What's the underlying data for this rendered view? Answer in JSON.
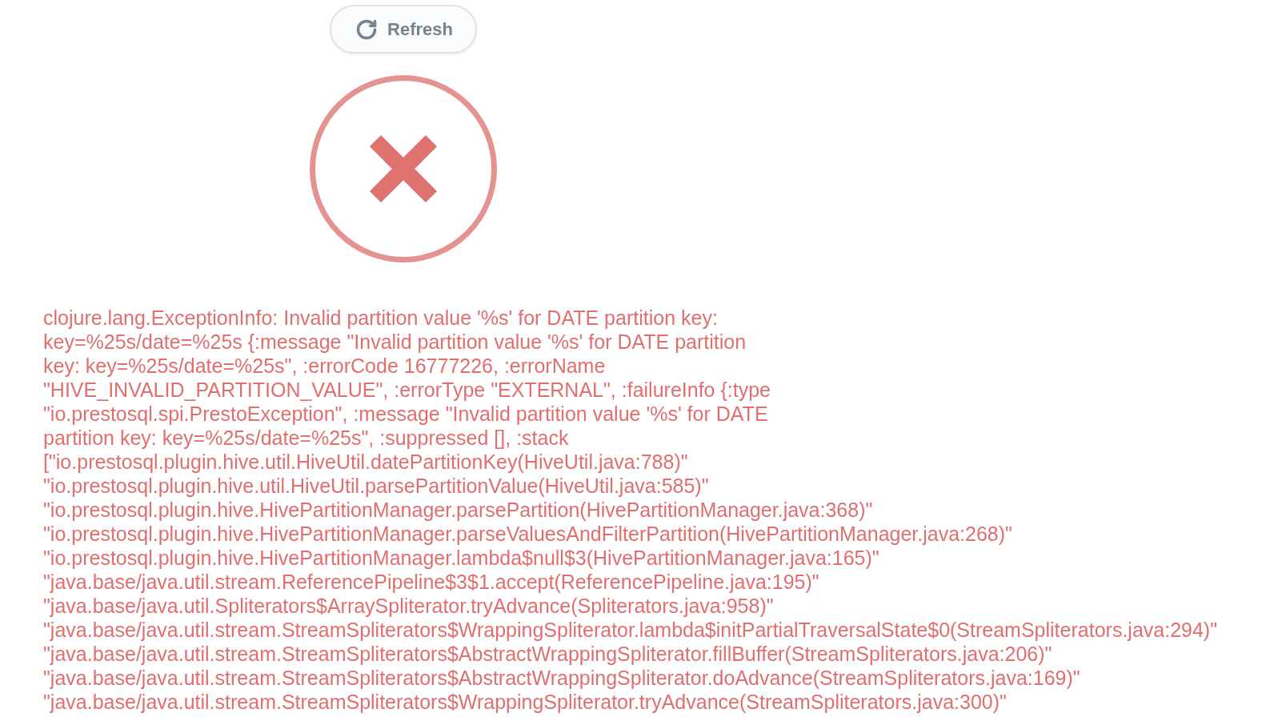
{
  "refresh_button": {
    "label": "Refresh"
  },
  "error": {
    "message": "clojure.lang.ExceptionInfo: Invalid partition value '%s' for DATE partition key: key=%25s/date=%25s {:message \"Invalid partition value '%s' for DATE partition key: key=%25s/date=%25s\", :errorCode 16777226, :errorName \"HIVE_INVALID_PARTITION_VALUE\", :errorType \"EXTERNAL\", :failureInfo {:type \"io.prestosql.spi.PrestoException\", :message \"Invalid partition value '%s' for DATE partition key: key=%25s/date=%25s\", :suppressed [], :stack",
    "stack": [
      "[\"io.prestosql.plugin.hive.util.HiveUtil.datePartitionKey(HiveUtil.java:788)\"",
      "\"io.prestosql.plugin.hive.util.HiveUtil.parsePartitionValue(HiveUtil.java:585)\"",
      "\"io.prestosql.plugin.hive.HivePartitionManager.parsePartition(HivePartitionManager.java:368)\"",
      "\"io.prestosql.plugin.hive.HivePartitionManager.parseValuesAndFilterPartition(HivePartitionManager.java:268)\"",
      "\"io.prestosql.plugin.hive.HivePartitionManager.lambda$null$3(HivePartitionManager.java:165)\"",
      "\"java.base/java.util.stream.ReferencePipeline$3$1.accept(ReferencePipeline.java:195)\"",
      "\"java.base/java.util.Spliterators$ArraySpliterator.tryAdvance(Spliterators.java:958)\"",
      "\"java.base/java.util.stream.StreamSpliterators$WrappingSpliterator.lambda$initPartialTraversalState$0(StreamSpliterators.java:294)\"",
      "\"java.base/java.util.stream.StreamSpliterators$AbstractWrappingSpliterator.fillBuffer(StreamSpliterators.java:206)\"",
      "\"java.base/java.util.stream.StreamSpliterators$AbstractWrappingSpliterator.doAdvance(StreamSpliterators.java:169)\"",
      "\"java.base/java.util.stream.StreamSpliterators$WrappingSpliterator.tryAdvance(StreamSpliterators.java:300)\""
    ]
  }
}
